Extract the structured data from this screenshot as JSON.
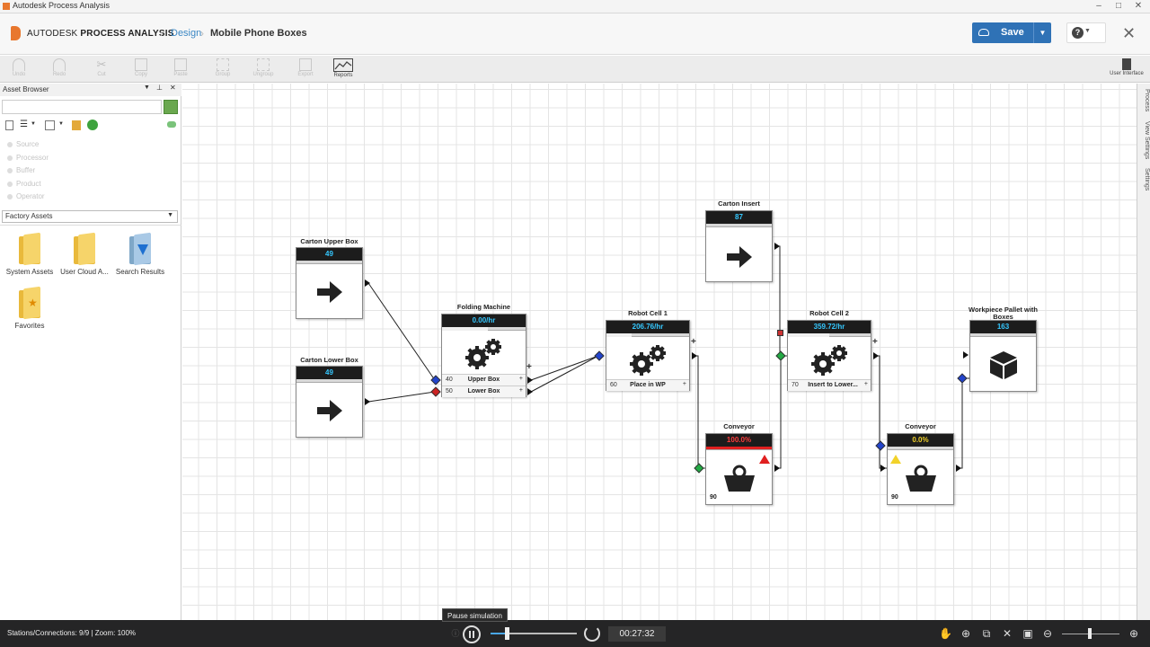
{
  "window": {
    "title": "Autodesk Process Analysis"
  },
  "header": {
    "brand_prefix": "AUTODESK",
    "brand_product": "PROCESS ANALYSIS",
    "breadcrumb": [
      "Design",
      "Mobile Phone Boxes"
    ],
    "save_label": "Save",
    "help_symbol": "?"
  },
  "toolbar": {
    "items": [
      {
        "label": "Undo",
        "icon": "undo-icon",
        "enabled": false
      },
      {
        "label": "Redo",
        "icon": "redo-icon",
        "enabled": false
      },
      {
        "label": "Cut",
        "icon": "cut-icon",
        "enabled": false
      },
      {
        "label": "Copy",
        "icon": "copy-icon",
        "enabled": false
      },
      {
        "label": "Paste",
        "icon": "paste-icon",
        "enabled": false
      },
      {
        "label": "Group",
        "icon": "group-icon",
        "enabled": false
      },
      {
        "label": "Ungroup",
        "icon": "ungroup-icon",
        "enabled": false
      },
      {
        "label": "Export",
        "icon": "export-icon",
        "enabled": false
      },
      {
        "label": "Reports",
        "icon": "reports-icon",
        "enabled": true
      }
    ],
    "right_label": "User Interface"
  },
  "asset_browser": {
    "title": "Asset Browser",
    "search_placeholder": "",
    "categories": [
      "Source",
      "Processor",
      "Buffer",
      "Product",
      "Operator"
    ],
    "dropdown_value": "Factory Assets",
    "folders": [
      "System Assets",
      "User Cloud A...",
      "Search Results",
      "Favorites"
    ]
  },
  "right_tabs": [
    "Process",
    "View Settings",
    "Settings"
  ],
  "nodes": {
    "carton_upper_box": {
      "title": "Carton Upper Box",
      "value": "49"
    },
    "carton_lower_box": {
      "title": "Carton Lower Box",
      "value": "49"
    },
    "folding_machine": {
      "title": "Folding Machine",
      "value": "0.00/hr",
      "rows": [
        {
          "num": "40",
          "label": "Upper Box"
        },
        {
          "num": "50",
          "label": "Lower Box"
        }
      ]
    },
    "robot_cell_1": {
      "title": "Robot Cell 1",
      "value": "206.76/hr",
      "rows": [
        {
          "num": "60",
          "label": "Place in WP"
        }
      ]
    },
    "carton_insert": {
      "title": "Carton Insert",
      "value": "87"
    },
    "robot_cell_2": {
      "title": "Robot Cell 2",
      "value": "359.72/hr",
      "rows": [
        {
          "num": "70",
          "label": "Insert to Lower..."
        }
      ]
    },
    "conveyor_1": {
      "title": "Conveyor",
      "value": "100.0%",
      "count": "90",
      "value_color": "#ff3b3b"
    },
    "conveyor_2": {
      "title": "Conveyor",
      "value": "0.0%",
      "count": "90",
      "value_color": "#f2d22a"
    },
    "workpiece_pallet": {
      "title": "Workpiece Pallet with Boxes",
      "value": "163"
    }
  },
  "statusbar": {
    "info": "Stations/Connections: 9/9 | Zoom: 100%",
    "tooltip": "Pause simulation",
    "timer": "00:27:32"
  }
}
